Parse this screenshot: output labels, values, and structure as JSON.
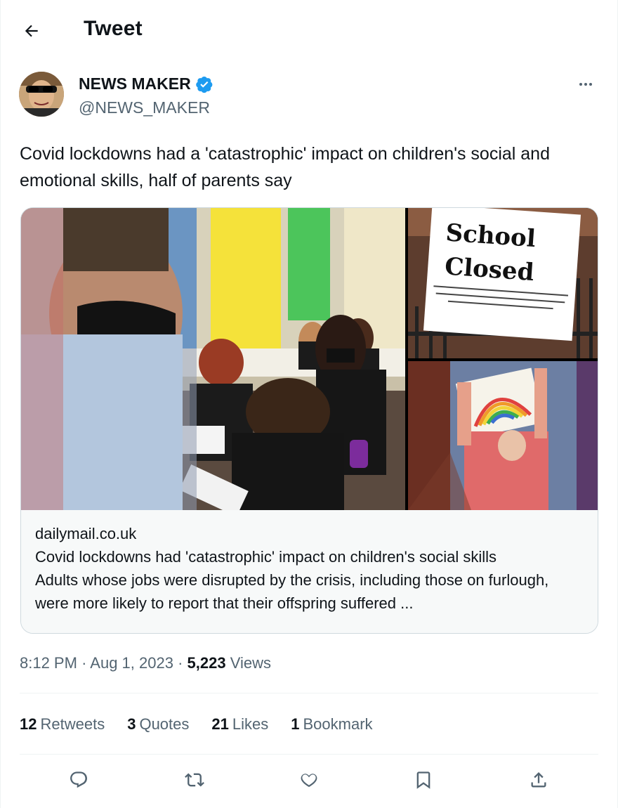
{
  "header": {
    "back_icon": "arrow-left-icon",
    "title": "Tweet"
  },
  "author": {
    "name": "NEWS MAKER",
    "handle": "@NEWS_MAKER",
    "verified_icon": "verified-badge-icon",
    "verified_color": "#1d9bf0"
  },
  "tweet": {
    "text": "Covid lockdowns had a 'catastrophic' impact on children's social and emotional skills, half of parents say"
  },
  "link_card": {
    "domain": "dailymail.co.uk",
    "title": "Covid lockdowns had 'catastrophic' impact on children's social skills",
    "description": "Adults whose jobs were disrupted by the crisis, including those on furlough, were more likely to report that their offspring suffered ...",
    "sign_text_line1": "School",
    "sign_text_line2": "Closed"
  },
  "meta": {
    "time": "8:12 PM",
    "date": "Aug 1, 2023",
    "views_count": "5,223",
    "views_label": "Views",
    "separator": "·"
  },
  "stats": {
    "retweets_count": "12",
    "retweets_label": "Retweets",
    "quotes_count": "3",
    "quotes_label": "Quotes",
    "likes_count": "21",
    "likes_label": "Likes",
    "bookmarks_count": "1",
    "bookmarks_label": "Bookmark"
  },
  "actions": {
    "reply_icon": "reply-icon",
    "retweet_icon": "retweet-icon",
    "like_icon": "heart-icon",
    "bookmark_icon": "bookmark-icon",
    "share_icon": "share-icon"
  },
  "colors": {
    "text": "#0f1419",
    "secondary": "#536471",
    "border": "#cfd9de",
    "accent": "#1d9bf0"
  }
}
